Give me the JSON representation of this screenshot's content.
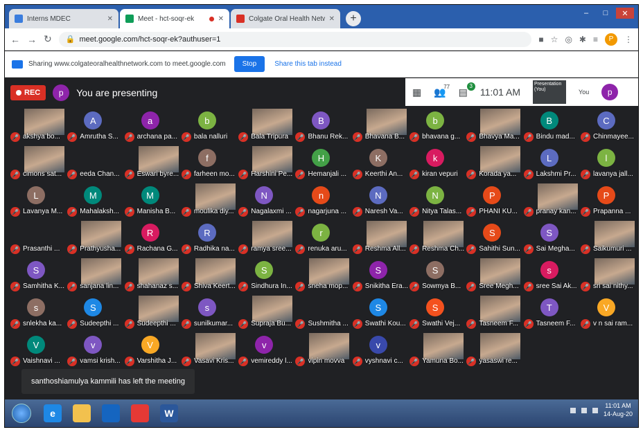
{
  "browser": {
    "tabs": [
      {
        "title": "Interns MDEC",
        "fav_color": "#3b7ddd"
      },
      {
        "title": "Meet - hct-soqr-ek",
        "fav_color": "#0f9d58",
        "recording": true
      },
      {
        "title": "Colgate Oral Health Netwo",
        "fav_color": "#d93025"
      }
    ],
    "url": "meet.google.com/hct-soqr-ek?authuser=1",
    "profile_initial": "P"
  },
  "share_bar": {
    "text": "Sharing www.colgateoralhealthnetwork.com to meet.google.com",
    "stop_label": "Stop",
    "share_tab_label": "Share this tab instead"
  },
  "meet": {
    "rec_label": "REC",
    "presenter_initial": "p",
    "presenting_text": "You are presenting",
    "participants_count": "77",
    "chat_count": "3",
    "time": "11:01 AM",
    "presentation_label": "Presentation (You)",
    "you_label": "You",
    "you_initial": "p"
  },
  "participants": [
    {
      "name": "akshya bo...",
      "initial": "",
      "video": true
    },
    {
      "name": "Amrutha S...",
      "initial": "A",
      "color": "#5c6bc0"
    },
    {
      "name": "archana pa...",
      "initial": "a",
      "color": "#8e24aa"
    },
    {
      "name": "bala nalluri",
      "initial": "b",
      "color": "#7cb342"
    },
    {
      "name": "Bala Tripura",
      "initial": "",
      "video": true
    },
    {
      "name": "Bhanu Rek...",
      "initial": "B",
      "color": "#7e57c2"
    },
    {
      "name": "Bhavana B...",
      "initial": "",
      "video": true
    },
    {
      "name": "bhavana g...",
      "initial": "b",
      "color": "#7cb342"
    },
    {
      "name": "Bhavya Ma...",
      "initial": "",
      "video": true
    },
    {
      "name": "Bindu mad...",
      "initial": "B",
      "color": "#00897b"
    },
    {
      "name": "Chinmayee...",
      "initial": "C",
      "color": "#5c6bc0"
    },
    {
      "name": "cimons sat...",
      "initial": "",
      "video": true
    },
    {
      "name": "eeda Chan...",
      "initial": "",
      "video": false,
      "color": "#202124"
    },
    {
      "name": "Eswari byre...",
      "initial": "",
      "video": true
    },
    {
      "name": "farheen mo...",
      "initial": "f",
      "color": "#8d6e63"
    },
    {
      "name": "Harshini Pe...",
      "initial": "",
      "video": true
    },
    {
      "name": "Hemanjali ...",
      "initial": "H",
      "color": "#43a047"
    },
    {
      "name": "Keerthi An...",
      "initial": "K",
      "color": "#8d6e63"
    },
    {
      "name": "kiran vepuri",
      "initial": "k",
      "color": "#d81b60"
    },
    {
      "name": "Korada ya...",
      "initial": "",
      "video": true
    },
    {
      "name": "Lakshmi Pr...",
      "initial": "L",
      "color": "#5c6bc0"
    },
    {
      "name": "lavanya jall...",
      "initial": "l",
      "color": "#7cb342"
    },
    {
      "name": "Lavanya M...",
      "initial": "L",
      "color": "#8d6e63"
    },
    {
      "name": "Mahalaksh...",
      "initial": "M",
      "color": "#00897b"
    },
    {
      "name": "Manisha B...",
      "initial": "M",
      "color": "#00897b"
    },
    {
      "name": "moulika diy...",
      "initial": "",
      "video": true
    },
    {
      "name": "Nagalaxmi ...",
      "initial": "N",
      "color": "#7e57c2"
    },
    {
      "name": "nagarjuna ...",
      "initial": "n",
      "color": "#e64a19"
    },
    {
      "name": "Naresh Va...",
      "initial": "N",
      "color": "#5c6bc0"
    },
    {
      "name": "Nitya Talas...",
      "initial": "N",
      "color": "#7cb342"
    },
    {
      "name": "PHANI KU...",
      "initial": "P",
      "color": "#e64a19"
    },
    {
      "name": "pranay kan...",
      "initial": "",
      "video": true
    },
    {
      "name": "Prapanna ...",
      "initial": "P",
      "color": "#e64a19"
    },
    {
      "name": "Prasanthi ...",
      "initial": "",
      "video": false,
      "color": "#263238"
    },
    {
      "name": "Prathyusha...",
      "initial": "",
      "video": true
    },
    {
      "name": "Rachana G...",
      "initial": "R",
      "color": "#d81b60"
    },
    {
      "name": "Radhika na...",
      "initial": "R",
      "color": "#5c6bc0"
    },
    {
      "name": "ramya sree...",
      "initial": "",
      "video": true
    },
    {
      "name": "renuka aru...",
      "initial": "r",
      "color": "#7cb342"
    },
    {
      "name": "Reshma All...",
      "initial": "",
      "video": true
    },
    {
      "name": "Reshma Ch...",
      "initial": "",
      "video": true
    },
    {
      "name": "Sahithi Sun...",
      "initial": "S",
      "color": "#e64a19"
    },
    {
      "name": "Sai Megha...",
      "initial": "S",
      "color": "#7e57c2"
    },
    {
      "name": "Saikumuri ...",
      "initial": "",
      "video": true
    },
    {
      "name": "Samhitha K...",
      "initial": "S",
      "color": "#7e57c2"
    },
    {
      "name": "sanjana lin...",
      "initial": "",
      "video": true
    },
    {
      "name": "shahanaz s...",
      "initial": "",
      "video": true
    },
    {
      "name": "Shiva Keert...",
      "initial": "",
      "video": true
    },
    {
      "name": "Sindhura In...",
      "initial": "S",
      "color": "#7cb342"
    },
    {
      "name": "sneha mop...",
      "initial": "",
      "video": true
    },
    {
      "name": "Snikitha Era...",
      "initial": "S",
      "color": "#8e24aa"
    },
    {
      "name": "Sowmya B...",
      "initial": "S",
      "color": "#8d6e63"
    },
    {
      "name": "Sree Megh...",
      "initial": "",
      "video": true
    },
    {
      "name": "sree Sai Ak...",
      "initial": "s",
      "color": "#d81b60"
    },
    {
      "name": "sri sai nithy...",
      "initial": "",
      "video": true
    },
    {
      "name": "snlekha ka...",
      "initial": "s",
      "color": "#8d6e63"
    },
    {
      "name": "Sudeepthi ...",
      "initial": "S",
      "color": "#1e88e5"
    },
    {
      "name": "Sudeepthi ...",
      "initial": "",
      "video": true
    },
    {
      "name": "sunilkumar...",
      "initial": "s",
      "color": "#7e57c2"
    },
    {
      "name": "Supraja Bu...",
      "initial": "",
      "video": true
    },
    {
      "name": "Sushmitha ...",
      "initial": "",
      "video": false,
      "color": "#202124"
    },
    {
      "name": "Swathi Kou...",
      "initial": "S",
      "color": "#1e88e5"
    },
    {
      "name": "Swathi Vej...",
      "initial": "S",
      "color": "#f4511e"
    },
    {
      "name": "Tasneem F...",
      "initial": "",
      "video": true
    },
    {
      "name": "Tasneem F...",
      "initial": "T",
      "color": "#7e57c2"
    },
    {
      "name": "v n sai ram...",
      "initial": "V",
      "color": "#f9a825"
    },
    {
      "name": "Vaishnavi ...",
      "initial": "V",
      "color": "#00897b"
    },
    {
      "name": "vamsi krish...",
      "initial": "v",
      "color": "#7e57c2"
    },
    {
      "name": "Varshitha J...",
      "initial": "V",
      "color": "#f9a825"
    },
    {
      "name": "Vasavi Kris...",
      "initial": "",
      "video": true
    },
    {
      "name": "vemireddy l...",
      "initial": "v",
      "color": "#8e24aa"
    },
    {
      "name": "vipin movva",
      "initial": "",
      "video": true
    },
    {
      "name": "vyshnavi c...",
      "initial": "v",
      "color": "#3949ab"
    },
    {
      "name": "Yamuna Bo...",
      "initial": "",
      "video": true
    },
    {
      "name": "yasaswi re...",
      "initial": "",
      "video": true
    }
  ],
  "toast": "santhoshiamulya kammili has left the meeting",
  "taskbar": {
    "time": "11:01 AM",
    "date": "14-Aug-20",
    "apps": [
      {
        "name": "ie-icon",
        "label": "e",
        "color": "#1e88e5"
      },
      {
        "name": "folder-icon",
        "label": "",
        "color": "#f2c14e"
      },
      {
        "name": "media-player-icon",
        "label": "",
        "color": "#1565c0"
      },
      {
        "name": "chrome-icon",
        "label": "",
        "color": "#e53935"
      },
      {
        "name": "word-icon",
        "label": "W",
        "color": "#2b579a"
      }
    ]
  }
}
